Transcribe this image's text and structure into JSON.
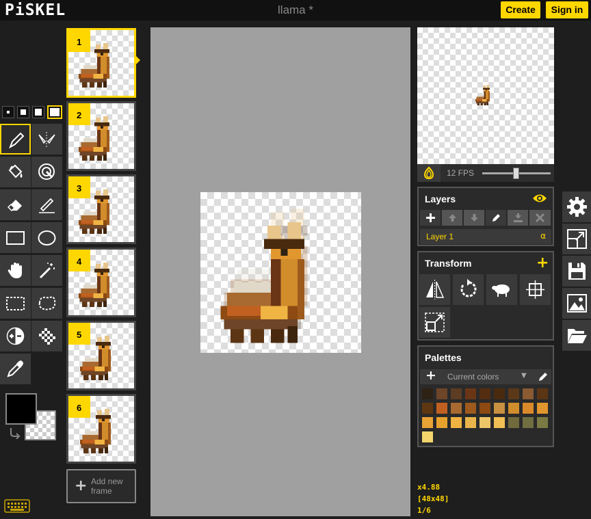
{
  "app": {
    "logo": "PiSKEL",
    "title": "llama *",
    "create_label": "Create",
    "signin_label": "Sign in"
  },
  "tools": {
    "pen_sizes": [
      "1",
      "2",
      "3",
      "4"
    ],
    "selected_pen_size": 4,
    "items": [
      {
        "name": "pen",
        "icon": "pen-icon",
        "active": true
      },
      {
        "name": "vertical-mirror-pen",
        "icon": "mirror-pen-icon"
      },
      {
        "name": "paint-bucket",
        "icon": "paint-bucket-icon"
      },
      {
        "name": "paint-same-pixels",
        "icon": "paint-all-icon"
      },
      {
        "name": "eraser",
        "icon": "eraser-icon"
      },
      {
        "name": "stroke",
        "icon": "stroke-icon"
      },
      {
        "name": "rectangle",
        "icon": "rectangle-icon"
      },
      {
        "name": "circle",
        "icon": "circle-icon"
      },
      {
        "name": "move",
        "icon": "hand-icon"
      },
      {
        "name": "shape-selection",
        "icon": "magic-wand-icon"
      },
      {
        "name": "rectangle-selection",
        "icon": "rect-select-icon"
      },
      {
        "name": "lasso-selection",
        "icon": "lasso-icon"
      },
      {
        "name": "lighten",
        "icon": "lighten-icon"
      },
      {
        "name": "dithering",
        "icon": "dither-icon"
      },
      {
        "name": "color-picker",
        "icon": "eyedropper-icon"
      }
    ],
    "primary_color": "#000000",
    "secondary_color": "transparent"
  },
  "frames": {
    "items": [
      {
        "number": "1",
        "selected": true
      },
      {
        "number": "2"
      },
      {
        "number": "3"
      },
      {
        "number": "4"
      },
      {
        "number": "5"
      },
      {
        "number": "6"
      }
    ],
    "add_label": "Add new frame"
  },
  "preview": {
    "fps_label": "12 FPS",
    "fps": 12
  },
  "layers": {
    "title": "Layers",
    "items": [
      {
        "name": "Layer 1",
        "alpha_label": "α"
      }
    ]
  },
  "transform": {
    "title": "Transform",
    "tools": [
      "flip-icon",
      "rotate-icon",
      "clone-icon",
      "center-icon",
      "crop-icon"
    ]
  },
  "palettes": {
    "title": "Palettes",
    "current": "Current colors",
    "colors": [
      "#2d2214",
      "#6e4528",
      "#5c3c22",
      "#6a3515",
      "#542e10",
      "#4a2a0e",
      "#5a3818",
      "#8a5a32",
      "#5c3514",
      "#5e3710",
      "#c16020",
      "#a86a30",
      "#9d5a1c",
      "#8d4a12",
      "#c89040",
      "#d18c2c",
      "#da8a2a",
      "#e2962e",
      "#e9a436",
      "#e7a22e",
      "#f0b443",
      "#e9b44b",
      "#eec66a",
      "#f0c054",
      "#706a3c",
      "#6f6f42",
      "#7b7a44",
      "#f3d56e"
    ],
    "accent": "#ffd700"
  },
  "status": {
    "zoom": "x4.88",
    "size": "[48x48]",
    "frame": "1/6"
  },
  "settings": {
    "items": [
      "gear-icon",
      "resize-icon",
      "save-icon",
      "export-image-icon",
      "open-folder-icon"
    ]
  }
}
